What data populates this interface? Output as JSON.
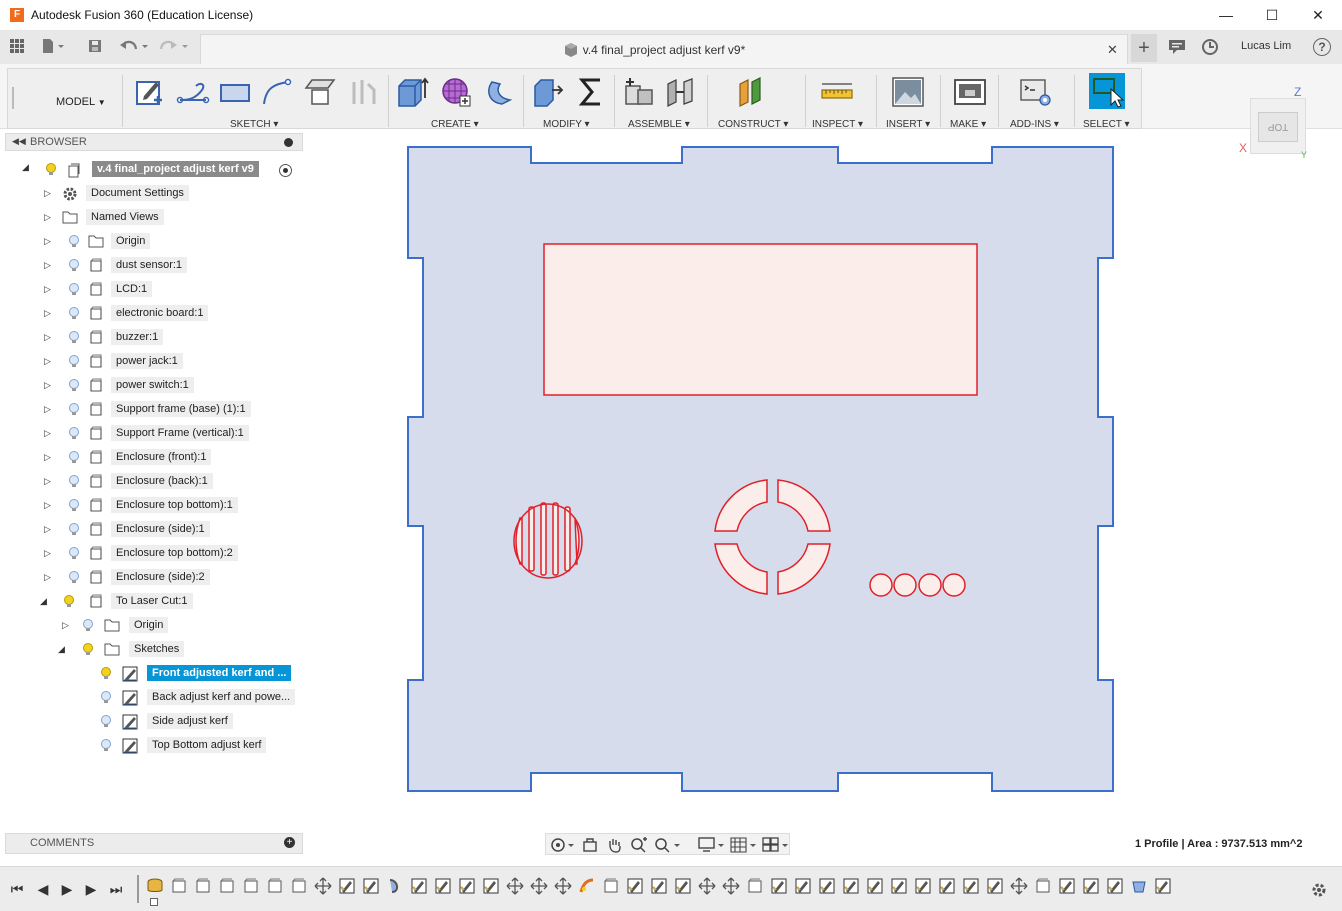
{
  "titlebar": {
    "app_logo": "F",
    "title": "Autodesk Fusion 360 (Education License)",
    "minimize": "—",
    "maximize": "☐",
    "close": "✕"
  },
  "qat": {
    "doc_title": "v.4 final_project adjust kerf v9*",
    "tab_close": "✕",
    "new_tab": "+",
    "user": "Lucas Lim",
    "help": "?"
  },
  "ribbon": {
    "workspace": "MODEL",
    "groups": [
      "SKETCH",
      "CREATE",
      "MODIFY",
      "ASSEMBLE",
      "CONSTRUCT",
      "INSPECT",
      "INSERT",
      "MAKE",
      "ADD-INS",
      "SELECT"
    ]
  },
  "browser": {
    "header": "BROWSER",
    "root": "v.4 final_project adjust kerf v9",
    "items": [
      {
        "label": "Document Settings",
        "icon": "gear-icon"
      },
      {
        "label": "Named Views",
        "icon": "folder-icon"
      },
      {
        "label": "Origin",
        "icon": "folder-icon"
      },
      {
        "label": "dust sensor:1",
        "icon": "component-icon"
      },
      {
        "label": "LCD:1",
        "icon": "component-icon"
      },
      {
        "label": "electronic board:1",
        "icon": "component-icon"
      },
      {
        "label": "buzzer:1",
        "icon": "component-icon"
      },
      {
        "label": "power jack:1",
        "icon": "component-icon"
      },
      {
        "label": "power switch:1",
        "icon": "component-icon"
      },
      {
        "label": "Support frame (base) (1):1",
        "icon": "component-icon"
      },
      {
        "label": "Support Frame (vertical):1",
        "icon": "component-icon"
      },
      {
        "label": "Enclosure (front):1",
        "icon": "component-icon"
      },
      {
        "label": "Enclosure (back):1",
        "icon": "component-icon"
      },
      {
        "label": "Enclosure top bottom):1",
        "icon": "component-icon"
      },
      {
        "label": "Enclosure (side):1",
        "icon": "component-icon"
      },
      {
        "label": "Enclosure top bottom):2",
        "icon": "component-icon"
      },
      {
        "label": "Enclosure (side):2",
        "icon": "component-icon"
      },
      {
        "label": "To Laser Cut:1",
        "icon": "component-icon"
      },
      {
        "label": "Origin",
        "icon": "folder-icon"
      },
      {
        "label": "Sketches",
        "icon": "folder-icon"
      },
      {
        "label": "Front adjusted kerf and ...",
        "icon": "sketch-icon"
      },
      {
        "label": "Back adjust kerf and powe...",
        "icon": "sketch-icon"
      },
      {
        "label": "Side adjust kerf",
        "icon": "sketch-icon"
      },
      {
        "label": "Top Bottom adjust kerf",
        "icon": "sketch-icon"
      }
    ]
  },
  "comments": {
    "header": "COMMENTS",
    "add": "+"
  },
  "status": {
    "profile": "1 Profile | Area : 9737.513 mm^2"
  },
  "viewcube": {
    "face": "TOP",
    "axis_z": "Z",
    "axis_x": "X",
    "axis_y": "Y"
  },
  "colors": {
    "accent": "#0696d7",
    "sketch_fill": "#d6dcec",
    "sketch_edge": "#3a6fcc",
    "cut_edge": "#e0202a",
    "cut_fill": "#fbeeea"
  }
}
